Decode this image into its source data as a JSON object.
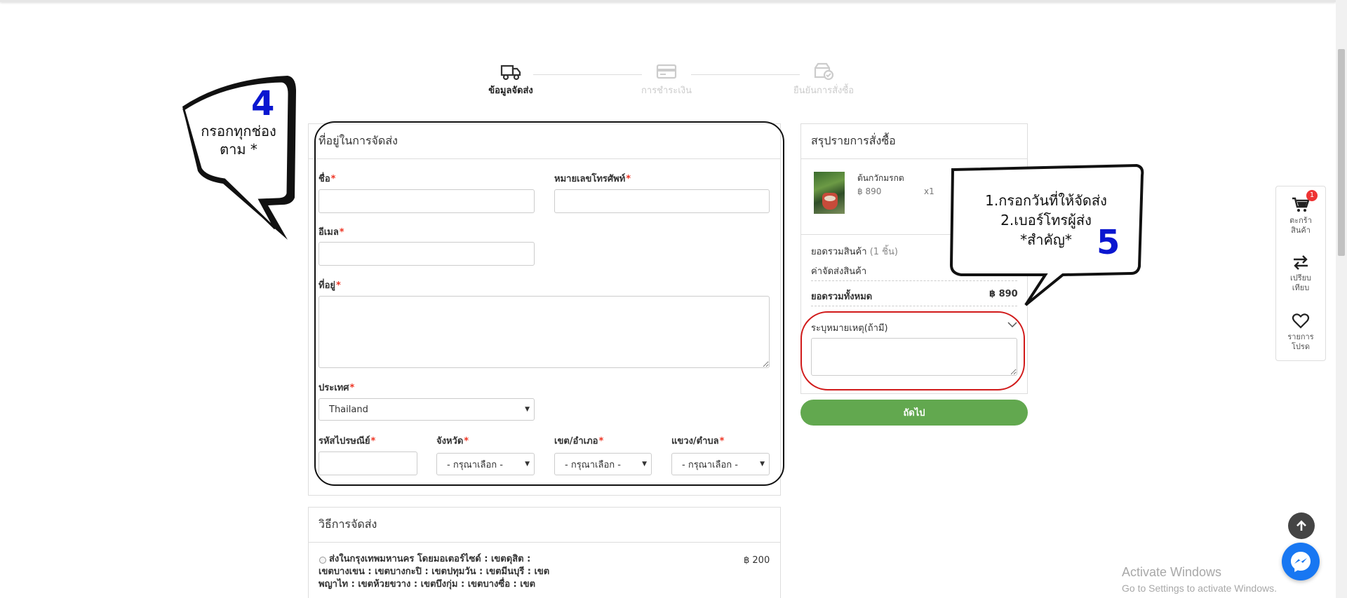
{
  "stepper": {
    "steps": [
      {
        "label": "ข้อมูลจัดส่ง",
        "icon": "truck-icon",
        "state": "active"
      },
      {
        "label": "การชำระเงิน",
        "icon": "credit-card-icon",
        "state": "inactive"
      },
      {
        "label": "ยืนยันการสั่งซื้อ",
        "icon": "order-confirm-icon",
        "state": "inactive"
      }
    ]
  },
  "address_form": {
    "title": "ที่อยู่ในการจัดส่ง",
    "required_mark": "*",
    "name_label": "ชื่อ",
    "phone_label": "หมายเลขโทรศัพท์",
    "email_label": "อีเมล",
    "address_label": "ที่อยู่",
    "country_label": "ประเทศ",
    "country_value": "Thailand",
    "postcode_label": "รหัสไปรษณีย์",
    "province_label": "จังหวัด",
    "district_label": "เขต/อำเภอ",
    "subdistrict_label": "แขวง/ตำบล",
    "select_placeholder": "- กรุณาเลือก -"
  },
  "shipping_method": {
    "title": "วิธีการจัดส่ง",
    "option_lines": [
      "ส่งในกรุงเทพมหานคร โดยมอเตอร์ไซด์ : เขตดุสิต :",
      "เขตบางเขน : เขตบางกะปิ : เขตปทุมวัน : เขตมีนบุรี : เขต",
      "พญาไท : เขตห้วยขวาง : เขตบึงกุ่ม : เขตบางซื่อ : เขต"
    ],
    "option_price": "฿ 200"
  },
  "order_summary": {
    "title": "สรุปรายการสั่งซื้อ",
    "product_name": "ต้นกวักมรกต",
    "product_price": "฿ 890",
    "product_qty": "x1",
    "subtotal_label": "ยอดรวมสินค้า",
    "subtotal_count": "(1 ชิ้น)",
    "shipping_label": "ค่าจัดส่งสินค้า",
    "total_label": "ยอดรวมทั้งหมด",
    "total_value": "฿ 890",
    "note_label": "ระบุหมายเหตุ(ถ้ามี)",
    "next_button": "ถัดไป"
  },
  "sidebar": {
    "cart_line1": "ตะกร้า",
    "cart_line2": "สินค้า",
    "cart_badge": "1",
    "compare_line1": "เปรียบ",
    "compare_line2": "เทียบ",
    "wishlist_line1": "รายการ",
    "wishlist_line2": "โปรด"
  },
  "annotations": {
    "bubble_left_number": "4",
    "bubble_left_line1": "กรอกทุกช่อง",
    "bubble_left_line2": "ตาม *",
    "bubble_right_line1": "1.กรอกวันที่ให้จัดส่ง",
    "bubble_right_line2": "2.เบอร์โทรผู้ส่ง",
    "bubble_right_line3": "*สำคัญ*",
    "bubble_right_number": "5"
  },
  "watermark": {
    "line1": "Activate Windows",
    "line2": "Go to Settings to activate Windows."
  },
  "colors": {
    "next_button": "#62a84f",
    "required": "#e32222",
    "annotation_number": "#0a16d0",
    "highlight_red": "#d11a1a",
    "messenger": "#1877f2"
  }
}
